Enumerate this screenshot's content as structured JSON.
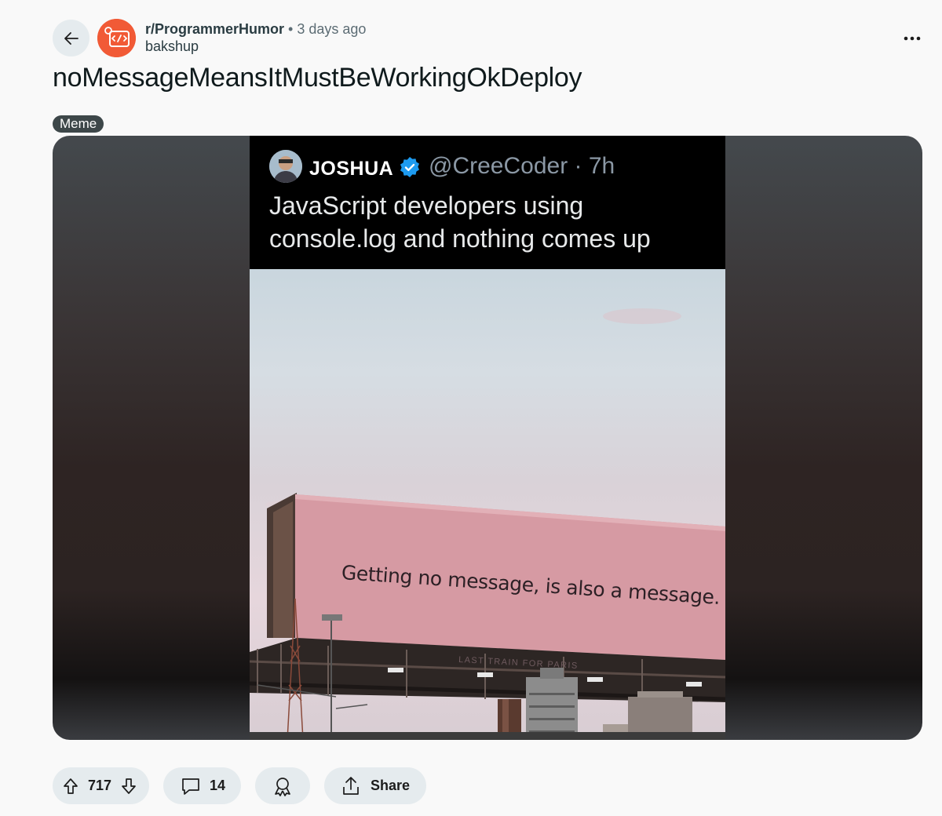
{
  "post": {
    "subreddit": "r/ProgrammerHumor",
    "separator": "•",
    "time_ago": "3 days ago",
    "author": "bakshup",
    "title": "noMessageMeansItMustBeWorkingOkDeploy",
    "flair": "Meme"
  },
  "media": {
    "tweet": {
      "name": "JOSHUA",
      "handle": "@CreeCoder · 7h",
      "text": "JavaScript developers using console.log and nothing comes up"
    },
    "billboard_text": "Getting no message, is also a message.",
    "billboard_credit": "LAST TRAIN FOR PARIS"
  },
  "actions": {
    "vote_count": "717",
    "comment_count": "14",
    "share_label": "Share"
  },
  "icons": {
    "back": "arrow-left-icon",
    "more": "more-horizontal-icon",
    "upvote": "arrow-up-icon",
    "downvote": "arrow-down-icon",
    "comment": "comment-bubble-icon",
    "award": "award-ribbon-icon",
    "share": "share-upload-icon"
  },
  "colors": {
    "subreddit_avatar": "#f15a36",
    "pill_background": "#e5ebee",
    "flair_background": "#3d4749",
    "verified_badge": "#1d9bf0"
  }
}
